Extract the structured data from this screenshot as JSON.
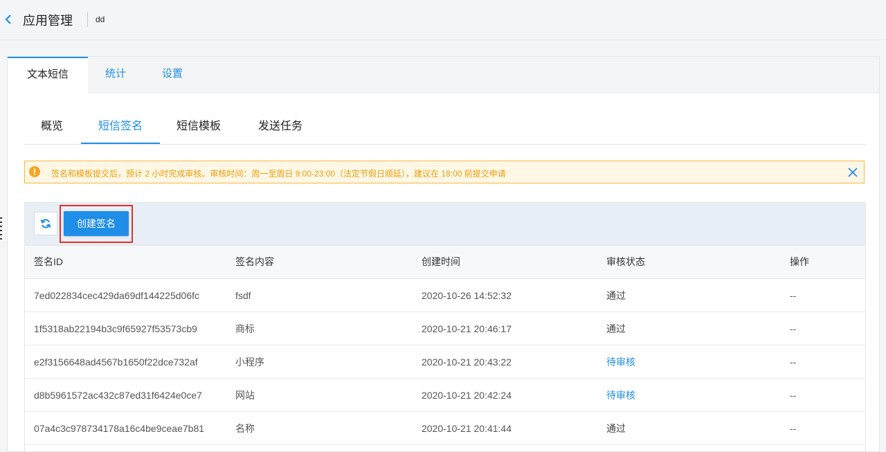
{
  "header": {
    "title": "应用管理",
    "app_name": "dd"
  },
  "card_tabs": [
    {
      "label": "文本短信",
      "active": true
    },
    {
      "label": "统计",
      "active": false
    },
    {
      "label": "设置",
      "active": false
    }
  ],
  "sub_tabs": [
    {
      "label": "概览",
      "active": false
    },
    {
      "label": "短信签名",
      "active": true
    },
    {
      "label": "短信模板",
      "active": false
    },
    {
      "label": "发送任务",
      "active": false
    }
  ],
  "notice": {
    "text": "签名和模板提交后，预计 2 小时完成审核。审核时间：周一至周日 9:00-23:00（法定节假日顺延），建议在 18:00 前提交申请"
  },
  "toolbar": {
    "create_label": "创建签名"
  },
  "table": {
    "columns": [
      "签名ID",
      "签名内容",
      "创建时间",
      "审核状态",
      "操作"
    ],
    "rows": [
      {
        "id": "7ed022834cec429da69df144225d06fc",
        "content": "fsdf",
        "created": "2020-10-26 14:52:32",
        "status": "通过",
        "action": "--"
      },
      {
        "id": "1f5318ab22194b3c9f65927f53573cb9",
        "content": "商标",
        "created": "2020-10-21 20:46:17",
        "status": "通过",
        "action": "--"
      },
      {
        "id": "e2f3156648ad4567b1650f22dce732af",
        "content": "小程序",
        "created": "2020-10-21 20:43:22",
        "status": "待审核",
        "action": "--"
      },
      {
        "id": "d8b5961572ac432c87ed31f6424e0ce7",
        "content": "网站",
        "created": "2020-10-21 20:42:24",
        "status": "待审核",
        "action": "--"
      },
      {
        "id": "07a4c3c978734178a16c4be9ceae7b81",
        "content": "名称",
        "created": "2020-10-21 20:41:44",
        "status": "通过",
        "action": "--"
      }
    ]
  },
  "colors": {
    "accent": "#1f8ee8",
    "warning": "#f5b73d",
    "highlight_border": "#e0302b"
  }
}
